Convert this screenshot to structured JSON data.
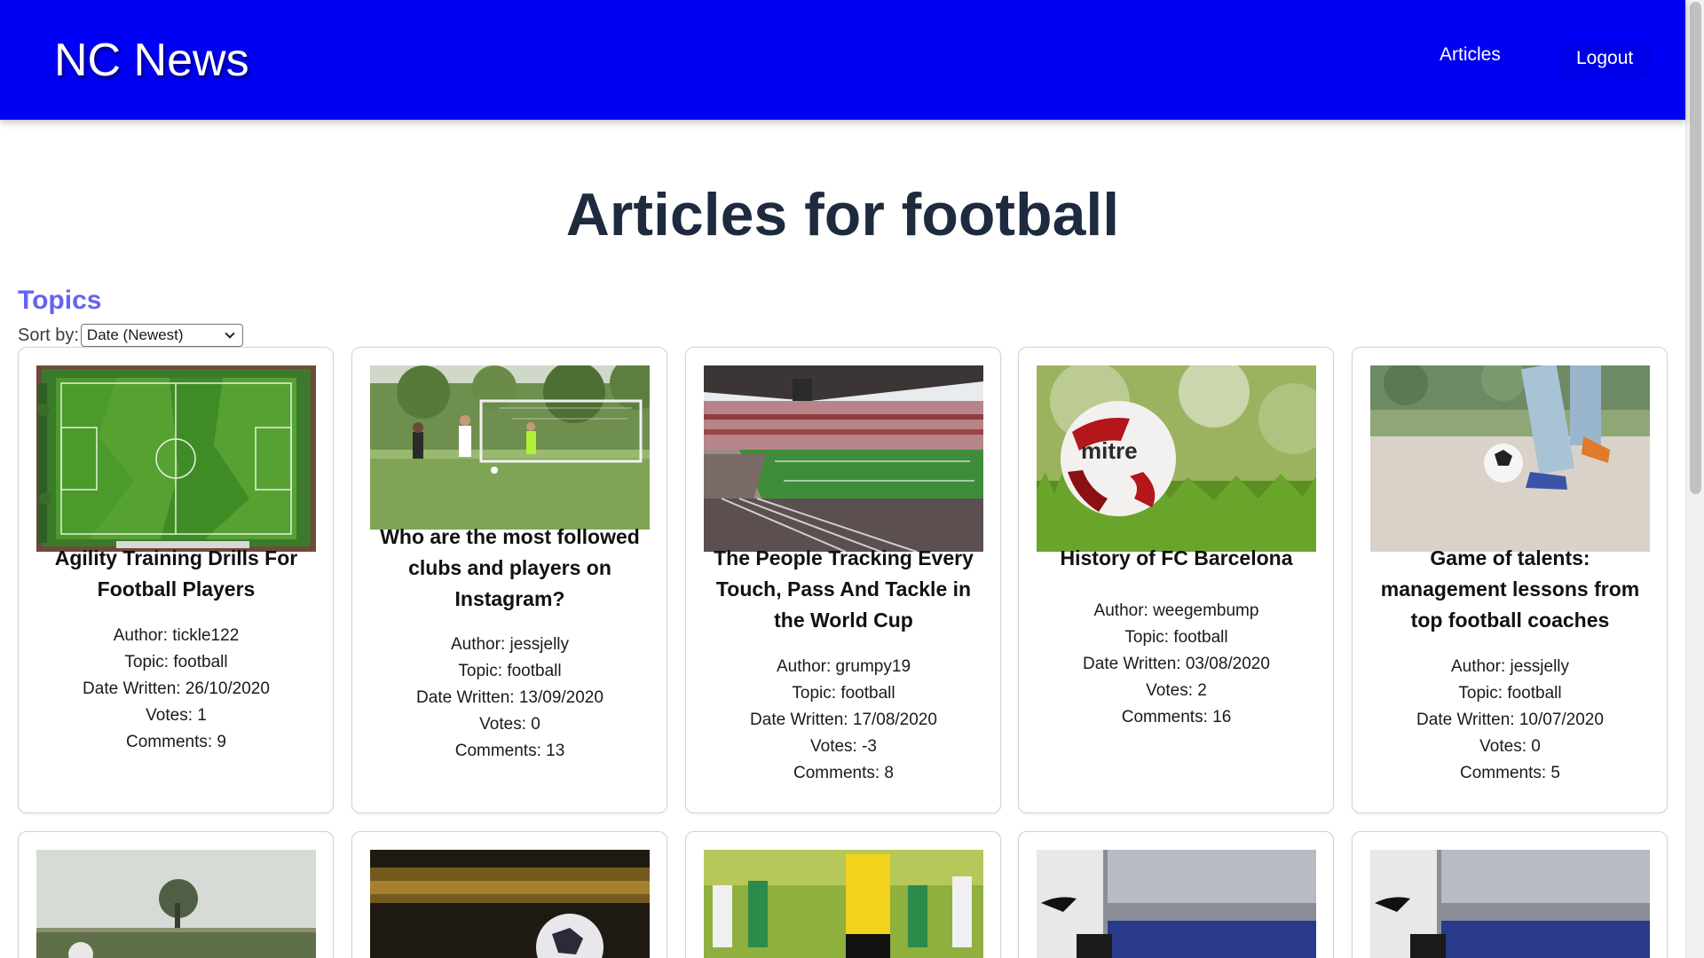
{
  "header": {
    "brand": "NC News",
    "nav": {
      "articles": "Articles",
      "logout": "Logout"
    }
  },
  "page": {
    "title": "Articles for football",
    "topics_label": "Topics",
    "sort_label": "Sort by:",
    "sort_value": "Date (Newest)"
  },
  "articles": [
    {
      "title": "Agility Training Drills For Football Players",
      "author": "Author: tickle122",
      "topic": "Topic: football",
      "date": "Date Written: 26/10/2020",
      "votes": "Votes: 1",
      "comments": "Comments: 9"
    },
    {
      "title": "Who are the most followed clubs and players on Instagram?",
      "author": "Author: jessjelly",
      "topic": "Topic: football",
      "date": "Date Written: 13/09/2020",
      "votes": "Votes: 0",
      "comments": "Comments: 13"
    },
    {
      "title": "The People Tracking Every Touch, Pass And Tackle in the World Cup",
      "author": "Author: grumpy19",
      "topic": "Topic: football",
      "date": "Date Written: 17/08/2020",
      "votes": "Votes: -3",
      "comments": "Comments: 8"
    },
    {
      "title": "History of FC Barcelona",
      "author": "Author: weegembump",
      "topic": "Topic: football",
      "date": "Date Written: 03/08/2020",
      "votes": "Votes: 2",
      "comments": "Comments: 16"
    },
    {
      "title": "Game of talents: management lessons from top football coaches",
      "author": "Author: jessjelly",
      "topic": "Topic: football",
      "date": "Date Written: 10/07/2020",
      "votes": "Votes: 0",
      "comments": "Comments: 5"
    }
  ],
  "colors": {
    "navbar": "#0000f5",
    "title": "#1e2a3e",
    "topics": "#6464f0"
  }
}
